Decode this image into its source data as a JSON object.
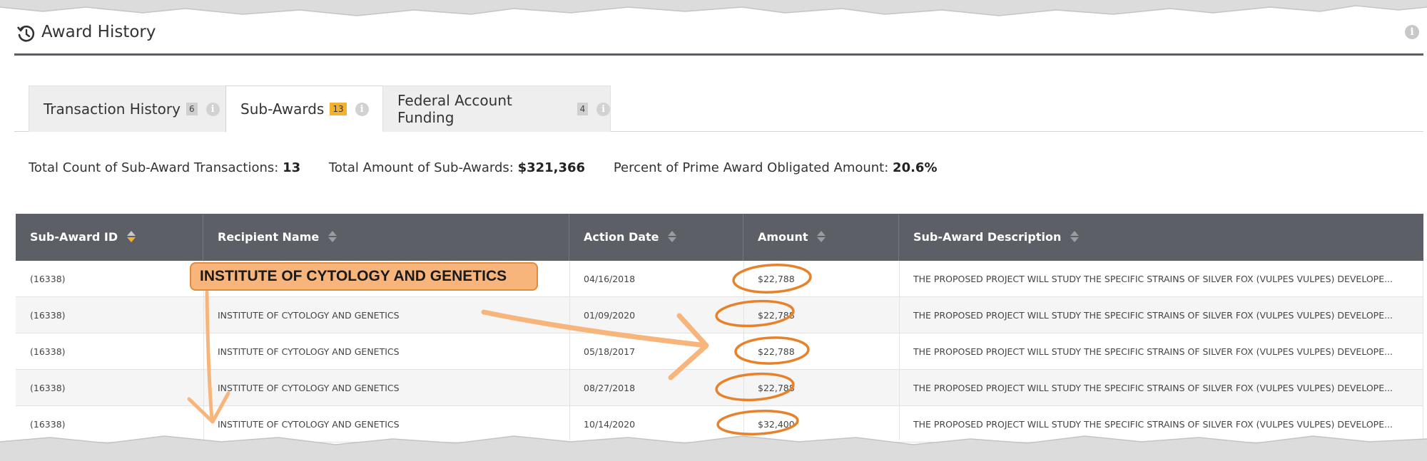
{
  "header": {
    "title": "Award History",
    "icon": "history-icon"
  },
  "tabs": [
    {
      "label": "Transaction History",
      "count": "6",
      "active": false
    },
    {
      "label": "Sub-Awards",
      "count": "13",
      "active": true
    },
    {
      "label": "Federal Account Funding",
      "count": "4",
      "active": false
    }
  ],
  "summary": {
    "count_label": "Total Count of Sub-Award Transactions:",
    "count_value": "13",
    "amount_label": "Total Amount of Sub-Awards:",
    "amount_value": "$321,366",
    "percent_label": "Percent of Prime Award Obligated Amount:",
    "percent_value": "20.6%"
  },
  "table": {
    "columns": [
      "Sub-Award ID",
      "Recipient Name",
      "Action Date",
      "Amount",
      "Sub-Award Description"
    ],
    "active_sort_column": "Sub-Award ID",
    "rows": [
      [
        "(16338)",
        "INSTITUTE OF CYTOLOGY AND GENETICS",
        "04/16/2018",
        "$22,788",
        "THE PROPOSED PROJECT WILL STUDY THE SPECIFIC STRAINS OF SILVER FOX (VULPES VULPES) DEVELOPE..."
      ],
      [
        "(16338)",
        "INSTITUTE OF CYTOLOGY AND GENETICS",
        "01/09/2020",
        "$22,788",
        "THE PROPOSED PROJECT WILL STUDY THE SPECIFIC STRAINS OF SILVER FOX (VULPES VULPES) DEVELOPE..."
      ],
      [
        "(16338)",
        "INSTITUTE OF CYTOLOGY AND GENETICS",
        "05/18/2017",
        "$22,788",
        "THE PROPOSED PROJECT WILL STUDY THE SPECIFIC STRAINS OF SILVER FOX (VULPES VULPES) DEVELOPE..."
      ],
      [
        "(16338)",
        "INSTITUTE OF CYTOLOGY AND GENETICS",
        "08/27/2018",
        "$22,788",
        "THE PROPOSED PROJECT WILL STUDY THE SPECIFIC STRAINS OF SILVER FOX (VULPES VULPES) DEVELOPE..."
      ],
      [
        "(16338)",
        "INSTITUTE OF CYTOLOGY AND GENETICS",
        "10/14/2020",
        "$32,400",
        "THE PROPOSED PROJECT WILL STUDY THE SPECIFIC STRAINS OF SILVER FOX (VULPES VULPES) DEVELOPE..."
      ]
    ]
  },
  "annotation": {
    "callout_text": "INSTITUTE OF CYTOLOGY AND GENETICS",
    "color": "#e8822a",
    "fill": "#f7b57c"
  },
  "colors": {
    "header_bg": "#5c5f66",
    "sort_active": "#f3b12e",
    "tab_count_active": "#f3b12e"
  }
}
